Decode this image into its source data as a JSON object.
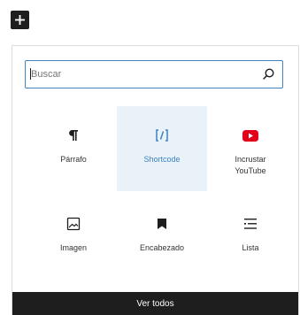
{
  "toolbar": {
    "add_icon": "plus-icon"
  },
  "search": {
    "placeholder": "Buscar",
    "icon": "search-icon"
  },
  "blocks": [
    {
      "label": "Párrafo",
      "icon": "paragraph-icon"
    },
    {
      "label": "Shortcode",
      "icon": "shortcode-icon",
      "selected": true
    },
    {
      "label": "Incrustar YouTube",
      "icon": "youtube-icon"
    },
    {
      "label": "Imagen",
      "icon": "image-icon"
    },
    {
      "label": "Encabezado",
      "icon": "bookmark-icon"
    },
    {
      "label": "Lista",
      "icon": "list-icon"
    }
  ],
  "footer": {
    "ver_todos_label": "Ver todos"
  },
  "colors": {
    "accent": "#3c82c4",
    "selected_bg": "#e9f1f9",
    "dark": "#1e1e1e",
    "youtube_red": "#e3001b"
  }
}
